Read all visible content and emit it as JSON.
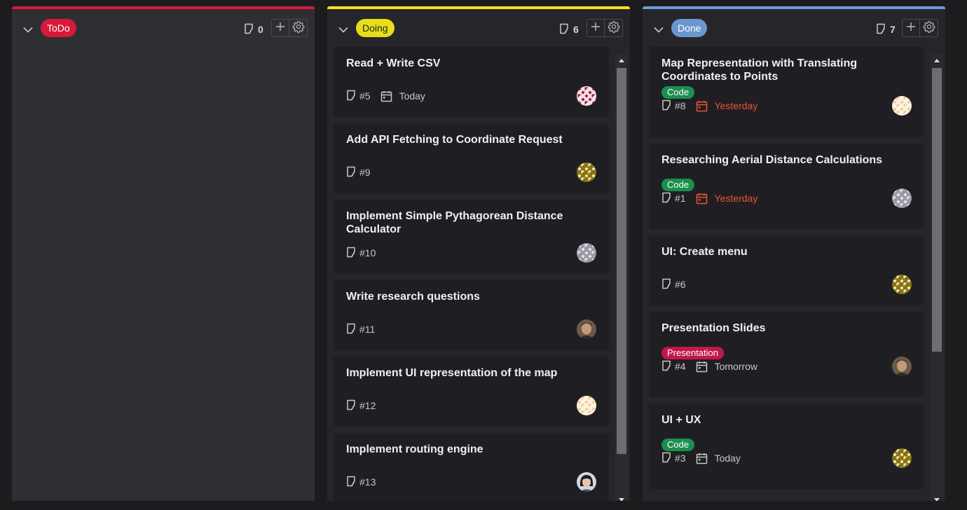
{
  "columns": [
    {
      "key": "todo",
      "name": "ToDo",
      "count": "0",
      "bar_color": "#d7193a",
      "pill_bg": "#d7193a",
      "pill_fg": "#ffffff",
      "cards": []
    },
    {
      "key": "doing",
      "name": "Doing",
      "count": "6",
      "bar_color": "#f2e51b",
      "pill_bg": "#e6de1a",
      "pill_fg": "#2a2a10",
      "cards": [
        {
          "title": "Read + Write CSV",
          "labels": [],
          "number": "#5",
          "date": "Today",
          "date_overdue": false,
          "avatar": "pattern-red"
        },
        {
          "title": "Add API Fetching to Coordinate Request",
          "labels": [],
          "number": "#9",
          "date": "",
          "date_overdue": false,
          "avatar": "pattern-olive"
        },
        {
          "title": "Implement Simple Pythagorean Distance Calculator",
          "labels": [],
          "number": "#10",
          "date": "",
          "date_overdue": false,
          "avatar": "pattern-gray"
        },
        {
          "title": "Write research questions",
          "labels": [],
          "number": "#11",
          "date": "",
          "date_overdue": false,
          "avatar": "photo-man"
        },
        {
          "title": "Implement UI representation of the map",
          "labels": [],
          "number": "#12",
          "date": "",
          "date_overdue": false,
          "avatar": "pattern-peach"
        },
        {
          "title": "Implement routing engine",
          "labels": [],
          "number": "#13",
          "date": "",
          "date_overdue": false,
          "avatar": "photo-woman"
        }
      ]
    },
    {
      "key": "done",
      "name": "Done",
      "count": "7",
      "bar_color": "#6b9bd6",
      "pill_bg": "#6b96cf",
      "pill_fg": "#ffffff",
      "cards": [
        {
          "title": "Map Representation with Translating Coordinates to Points",
          "labels": [
            {
              "text": "Code",
              "kind": "code"
            }
          ],
          "number": "#8",
          "date": "Yesterday",
          "date_overdue": true,
          "avatar": "pattern-peach"
        },
        {
          "title": "Researching Aerial Distance Calculations",
          "labels": [
            {
              "text": "Code",
              "kind": "code"
            }
          ],
          "number": "#1",
          "date": "Yesterday",
          "date_overdue": true,
          "avatar": "pattern-gray"
        },
        {
          "title": "UI: Create menu",
          "labels": [],
          "number": "#6",
          "date": "",
          "date_overdue": false,
          "avatar": "pattern-olive"
        },
        {
          "title": "Presentation Slides",
          "labels": [
            {
              "text": "Presentation",
              "kind": "presentation"
            }
          ],
          "number": "#4",
          "date": "Tomorrow",
          "date_overdue": false,
          "avatar": "photo-man"
        },
        {
          "title": "UI + UX",
          "labels": [
            {
              "text": "Code",
              "kind": "code"
            }
          ],
          "number": "#3",
          "date": "Today",
          "date_overdue": false,
          "avatar": "pattern-olive"
        }
      ]
    }
  ],
  "scrollbars": {
    "doing": {
      "thumb_start": 0.0,
      "thumb_fraction": 0.91
    },
    "done": {
      "thumb_start": 0.0,
      "thumb_fraction": 0.67
    }
  }
}
